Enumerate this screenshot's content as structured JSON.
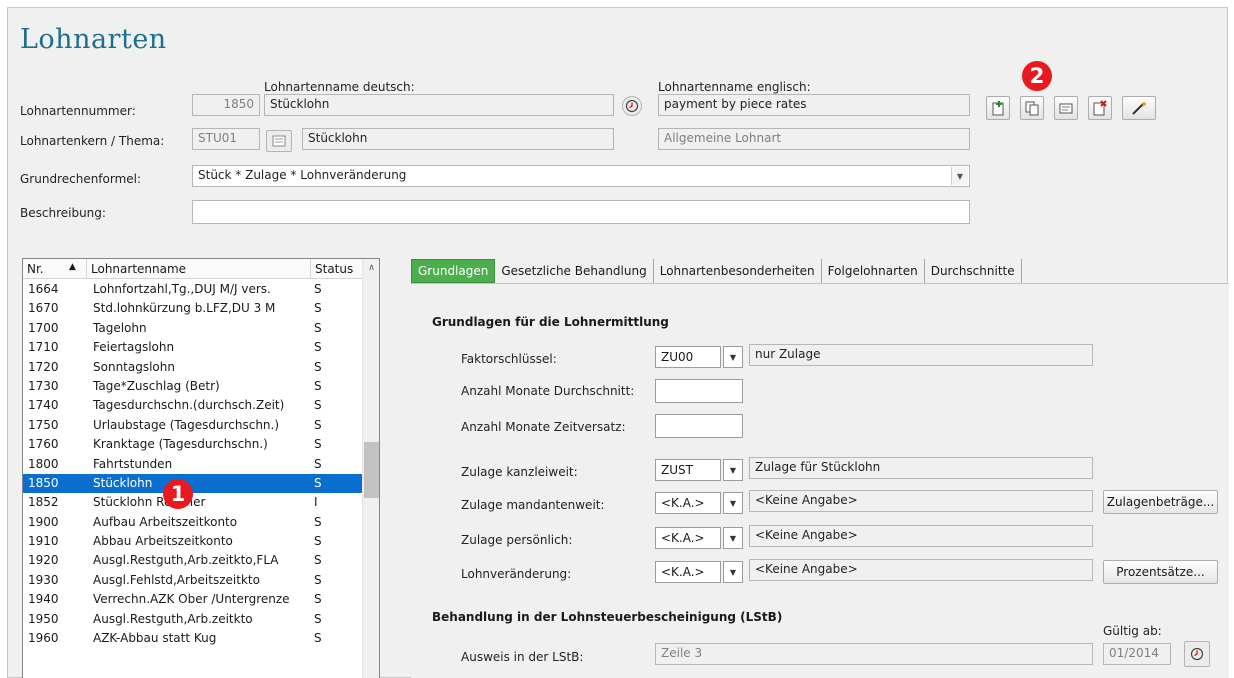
{
  "title": "Lohnarten",
  "header": {
    "name_de_label": "Lohnartenname deutsch:",
    "name_en_label": "Lohnartenname englisch:",
    "nummer_label": "Lohnartennummer:",
    "nummer_value": "1850",
    "name_de_value": "Stücklohn",
    "name_en_value": "payment by piece rates",
    "kern_label": "Lohnartenkern / Thema:",
    "kern_code": "STU01",
    "kern_name": "Stücklohn",
    "kern_en": "Allgemeine Lohnart",
    "formel_label": "Grundrechenformel:",
    "formel_value": "Stück * Zulage * Lohnveränderung",
    "beschreibung_label": "Beschreibung:",
    "beschreibung_value": ""
  },
  "badges": {
    "one": "1",
    "two": "2"
  },
  "list": {
    "columns": [
      "Nr.",
      "Lohnartenname",
      "Status"
    ],
    "rows": [
      {
        "nr": "1664",
        "name": "Lohnfortzahl,Tg.,DUJ M/J vers.",
        "status": "S"
      },
      {
        "nr": "1670",
        "name": "Std.lohnkürzung b.LFZ,DU 3 M",
        "status": "S"
      },
      {
        "nr": "1700",
        "name": "Tagelohn",
        "status": "S"
      },
      {
        "nr": "1710",
        "name": "Feiertagslohn",
        "status": "S"
      },
      {
        "nr": "1720",
        "name": "Sonntagslohn",
        "status": "S"
      },
      {
        "nr": "1730",
        "name": "Tage*Zuschlag (Betr)",
        "status": "S"
      },
      {
        "nr": "1740",
        "name": "Tagesdurchschn.(durchsch.Zeit)",
        "status": "S"
      },
      {
        "nr": "1750",
        "name": "Urlaubstage (Tagesdurchschn.)",
        "status": "S"
      },
      {
        "nr": "1760",
        "name": "Kranktage (Tagesdurchschn.)",
        "status": "S"
      },
      {
        "nr": "1800",
        "name": "Fahrtstunden",
        "status": "S"
      },
      {
        "nr": "1850",
        "name": "Stücklohn",
        "status": "S"
      },
      {
        "nr": "1852",
        "name": "Stücklohn Rechner",
        "status": "I"
      },
      {
        "nr": "1900",
        "name": "Aufbau Arbeitszeitkonto",
        "status": "S"
      },
      {
        "nr": "1910",
        "name": "Abbau Arbeitszeitkonto",
        "status": "S"
      },
      {
        "nr": "1920",
        "name": "Ausgl.Restguth,Arb.zeitkto,FLA",
        "status": "S"
      },
      {
        "nr": "1930",
        "name": "Ausgl.Fehlstd,Arbeitszeitkto",
        "status": "S"
      },
      {
        "nr": "1940",
        "name": "Verrechn.AZK Ober /Untergrenze",
        "status": "S"
      },
      {
        "nr": "1950",
        "name": "Ausgl.Restguth,Arb.zeitkto",
        "status": "S"
      },
      {
        "nr": "1960",
        "name": "AZK-Abbau statt Kug",
        "status": "S"
      }
    ]
  },
  "tabs": [
    "Grundlagen",
    "Gesetzliche Behandlung",
    "Lohnartenbesonderheiten",
    "Folgelohnarten",
    "Durchschnitte"
  ],
  "grundlagen": {
    "section_title": "Grundlagen für die Lohnermittlung",
    "faktor_label": "Faktorschlüssel:",
    "faktor_value": "ZU00",
    "faktor_desc": "nur Zulage",
    "anz_durchschnitt_label": "Anzahl Monate Durchschnitt:",
    "anz_zeitversatz_label": "Anzahl Monate Zeitversatz:",
    "zulage_kanzlei_label": "Zulage kanzleiweit:",
    "zulage_kanzlei_value": "ZUST",
    "zulage_kanzlei_desc": "Zulage für Stücklohn",
    "zulage_mandant_label": "Zulage mandantenweit:",
    "zulage_mandant_value": "<K.A.>",
    "zulage_mandant_desc": "<Keine Angabe>",
    "zulagenbetraege_button": "Zulagenbeträge...",
    "zulage_persoenlich_label": "Zulage persönlich:",
    "zulage_persoenlich_value": "<K.A.>",
    "zulage_persoenlich_desc": "<Keine Angabe>",
    "lohnveraenderung_label": "Lohnveränderung:",
    "lohnveraenderung_value": "<K.A.>",
    "lohnveraenderung_desc": "<Keine Angabe>",
    "prozentsaetze_button": "Prozentsätze...",
    "lstb_title": "Behandlung in der Lohnsteuerbescheinigung (LStB)",
    "gueltig_label": "Gültig ab:",
    "ausweis_label": "Ausweis in der LStB:",
    "ausweis_value": "Zeile 3",
    "gueltig_value": "01/2014"
  },
  "colors": {
    "accent_title": "#1b6f8f",
    "tab_active": "#4cae4c",
    "row_selected": "#0a6fcf",
    "badge": "#e8191f"
  }
}
